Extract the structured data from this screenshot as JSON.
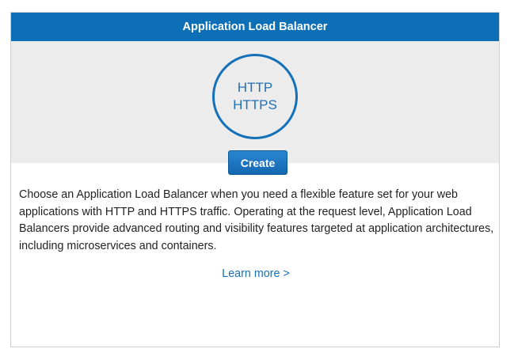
{
  "card": {
    "title": "Application Load Balancer",
    "protocols": [
      "HTTP",
      "HTTPS"
    ],
    "create_label": "Create",
    "description": "Choose an Application Load Balancer when you need a flexible feature set for your web applications with HTTP and HTTPS traffic. Operating at the request level, Application Load Balancers provide advanced routing and visibility features targeted at application architectures, including microservices and containers.",
    "learn_more_label": "Learn more >"
  },
  "colors": {
    "header_bg": "#0d6fb6",
    "hero_bg": "#ececec",
    "accent_blue": "#1470b8",
    "link": "#1a6fb6"
  }
}
